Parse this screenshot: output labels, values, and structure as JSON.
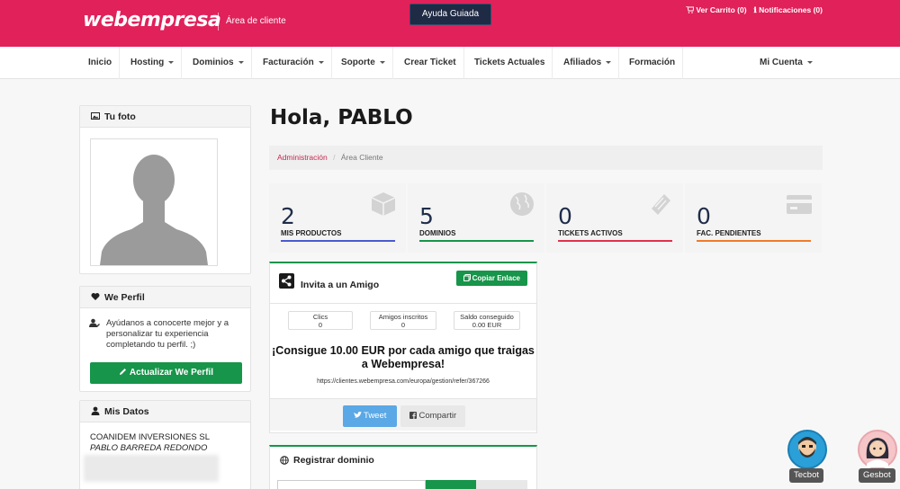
{
  "header": {
    "brand": "webempresa",
    "area_cliente": "Área de cliente",
    "ayuda_guiada": "Ayuda Guiada",
    "ver_carrito": "Ver Carrito (0)",
    "notificaciones": "Notificaciones (0)"
  },
  "nav": {
    "items": [
      "Inicio",
      "Hosting",
      "Dominios",
      "Facturación",
      "Soporte",
      "Crear Ticket",
      "Tickets Actuales",
      "Afiliados",
      "Formación"
    ],
    "mi_cuenta": "Mi Cuenta"
  },
  "sidebar": {
    "tu_foto": "Tu foto",
    "we_perfil": "We Perfil",
    "perfil_text": "Ayúdanos a conocerte mejor y a personalizar tu experiencia completando tu perfil. ;)",
    "actualizar_button": "Actualizar We Perfil",
    "mis_datos": "Mis Datos",
    "company": "COANIDEM INVERSIONES SL",
    "person": "PABLO BARREDA REDONDO"
  },
  "main": {
    "greeting": "Hola, PABLO",
    "breadcrumb": {
      "admin": "Administración",
      "current": "Área Cliente"
    },
    "stats": [
      {
        "value": "2",
        "label": "MIS PRODUCTOS",
        "color": "#4a5bd0"
      },
      {
        "value": "5",
        "label": "DOMINIOS",
        "color": "#17954a"
      },
      {
        "value": "0",
        "label": "TICKETS ACTIVOS",
        "color": "#e0324a"
      },
      {
        "value": "0",
        "label": "FAC. PENDIENTES",
        "color": "#f07b2b"
      }
    ],
    "invite": {
      "title": "Invita a un Amigo",
      "copy_button": "Copiar Enlace",
      "clics_label": "Clics",
      "clics_value": "0",
      "amigos_label": "Amigos inscritos",
      "amigos_value": "0",
      "saldo_label": "Saldo conseguido",
      "saldo_value": "0.00 EUR",
      "promo": "¡Consigue 10.00 EUR por cada amigo que traigas a Webempresa!",
      "link": "https://clientes.webempresa.com/europa/gestion/refer/367266",
      "tweet": "Tweet",
      "compartir": "Compartir"
    },
    "registrar": {
      "title": "Registrar dominio"
    }
  },
  "bots": {
    "tecbot": "Tecbot",
    "gesbot": "Gesbot"
  }
}
